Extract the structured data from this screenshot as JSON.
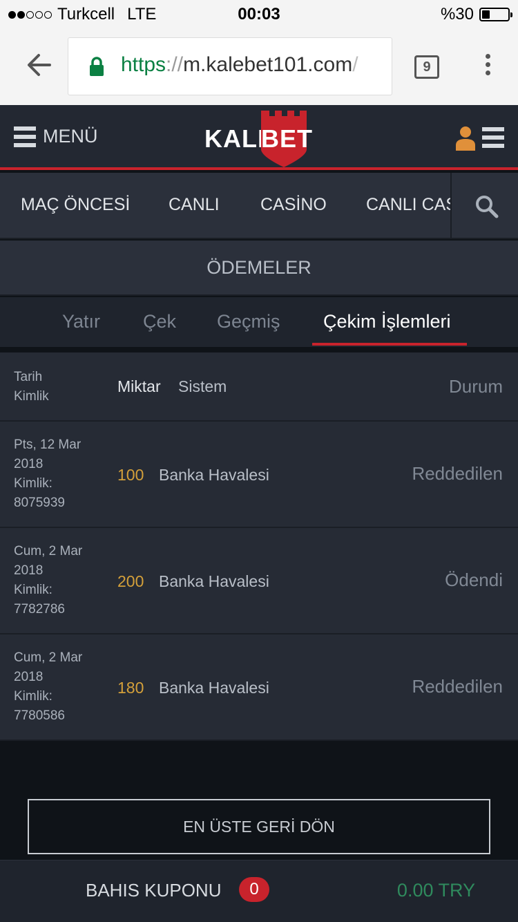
{
  "status_bar": {
    "signal_dots_filled": 2,
    "signal_dots_total": 5,
    "carrier": "Turkcell",
    "network": "LTE",
    "time": "00:03",
    "battery_text": "%30",
    "battery_level": 0.3
  },
  "browser": {
    "url_scheme": "https",
    "url_separator": "://",
    "url_host": "m.kalebet101.com",
    "url_tail": "/",
    "tab_count": "9",
    "icons": {
      "back": "back-arrow-icon",
      "lock": "lock-icon",
      "menu": "kebab-menu-icon"
    }
  },
  "header": {
    "menu_label": "MENÜ",
    "logo_left": "KALE",
    "logo_right": "BET",
    "brand_red": "#c8232c",
    "icons": {
      "menu": "hamburger-icon",
      "user": "user-icon",
      "right_menu": "hamburger-icon"
    }
  },
  "category_nav": {
    "items": [
      "MAÇ ÖNCESİ",
      "CANLI",
      "CASİNO",
      "CANLI CASİNO"
    ],
    "search_icon": "search-icon"
  },
  "page_title": "ÖDEMELER",
  "subtabs": {
    "items": [
      "Yatır",
      "Çek",
      "Geçmiş",
      "Çekim İşlemleri"
    ],
    "active": "Çekim İşlemleri"
  },
  "table": {
    "headers": {
      "date": "Tarih",
      "id": "Kimlik",
      "amount": "Miktar",
      "system": "Sistem",
      "status": "Durum"
    },
    "rows": [
      {
        "date": "Pts, 12 Mar",
        "year": "2018",
        "id_label": "Kimlik:",
        "id": "8075939",
        "amount": "100",
        "system": "Banka Havalesi",
        "status": "Reddedilen"
      },
      {
        "date": "Cum, 2 Mar",
        "year": "2018",
        "id_label": "Kimlik:",
        "id": "7782786",
        "amount": "200",
        "system": "Banka Havalesi",
        "status": "Ödendi"
      },
      {
        "date": "Cum, 2 Mar",
        "year": "2018",
        "id_label": "Kimlik:",
        "id": "7780586",
        "amount": "180",
        "system": "Banka Havalesi",
        "status": "Reddedilen"
      }
    ],
    "amount_color": "#d4a03a"
  },
  "back_to_top": "EN ÜSTE GERİ DÖN",
  "betslip": {
    "label": "BAHIS KUPONU",
    "count": "0",
    "total": "0.00 TRY",
    "total_color": "#2f8a5d"
  }
}
